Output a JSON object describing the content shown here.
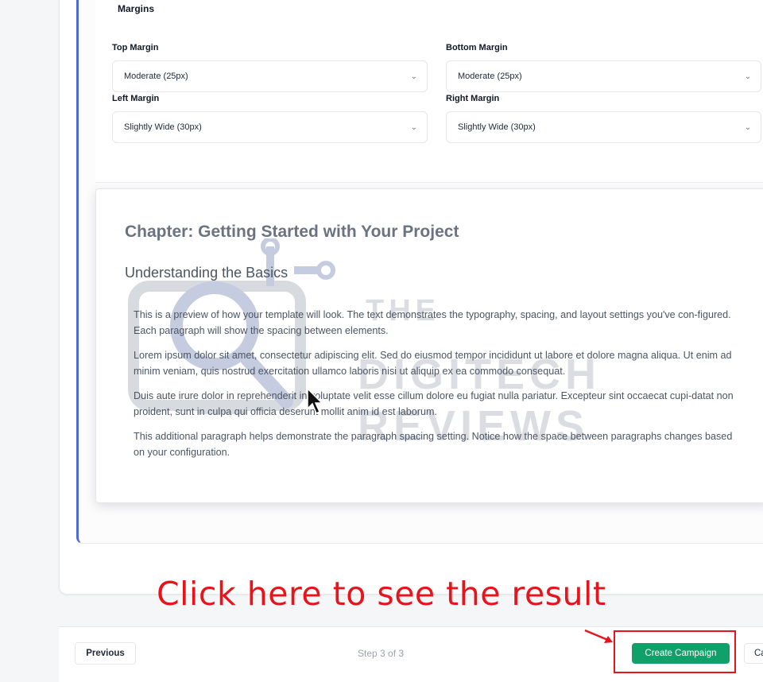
{
  "margins": {
    "title": "Margins",
    "top": {
      "label": "Top Margin",
      "value": "Moderate (25px)"
    },
    "bottom": {
      "label": "Bottom Margin",
      "value": "Moderate (25px)"
    },
    "left": {
      "label": "Left Margin",
      "value": "Slightly Wide (30px)"
    },
    "right": {
      "label": "Right Margin",
      "value": "Slightly Wide (30px)"
    },
    "chevron": "⌄"
  },
  "preview": {
    "heading": "Chapter: Getting Started with Your Project",
    "subheading": "Understanding the Basics",
    "paragraphs": [
      "This is a preview of how your template will look. The text demonstrates the typography, spacing, and layout settings you've con-figured. Each paragraph will show the spacing between elements.",
      "Lorem ipsum dolor sit amet, consectetur adipiscing elit. Sed do eiusmod tempor incididunt ut labore et dolore magna aliqua. Ut enim ad minim veniam, quis nostrud exercitation ullamco laboris nisi ut aliquip ex ea commodo consequat.",
      "Duis aute irure dolor in reprehenderit in voluptate velit esse cillum dolore eu fugiat nulla pariatur. Excepteur sint occaecat cupi-datat non proident, sunt in culpa qui officia deserunt mollit anim id est laborum.",
      "This additional paragraph helps demonstrate the paragraph spacing setting. Notice how the space between paragraphs changes based on your configuration."
    ]
  },
  "watermark": {
    "line1": "THE",
    "line2": "DIGITECH",
    "line3": "REVIEWS"
  },
  "footer": {
    "previous_label": "Previous",
    "step_text": "Step 3 of 3",
    "create_label": "Create Campaign",
    "cancel_label": "Cancel"
  },
  "annotation": {
    "text": "Click here to see the result"
  },
  "colors": {
    "accent_green": "#10a06a",
    "annotation_red": "#e8141b",
    "frame_blue": "#4f6bd8"
  }
}
